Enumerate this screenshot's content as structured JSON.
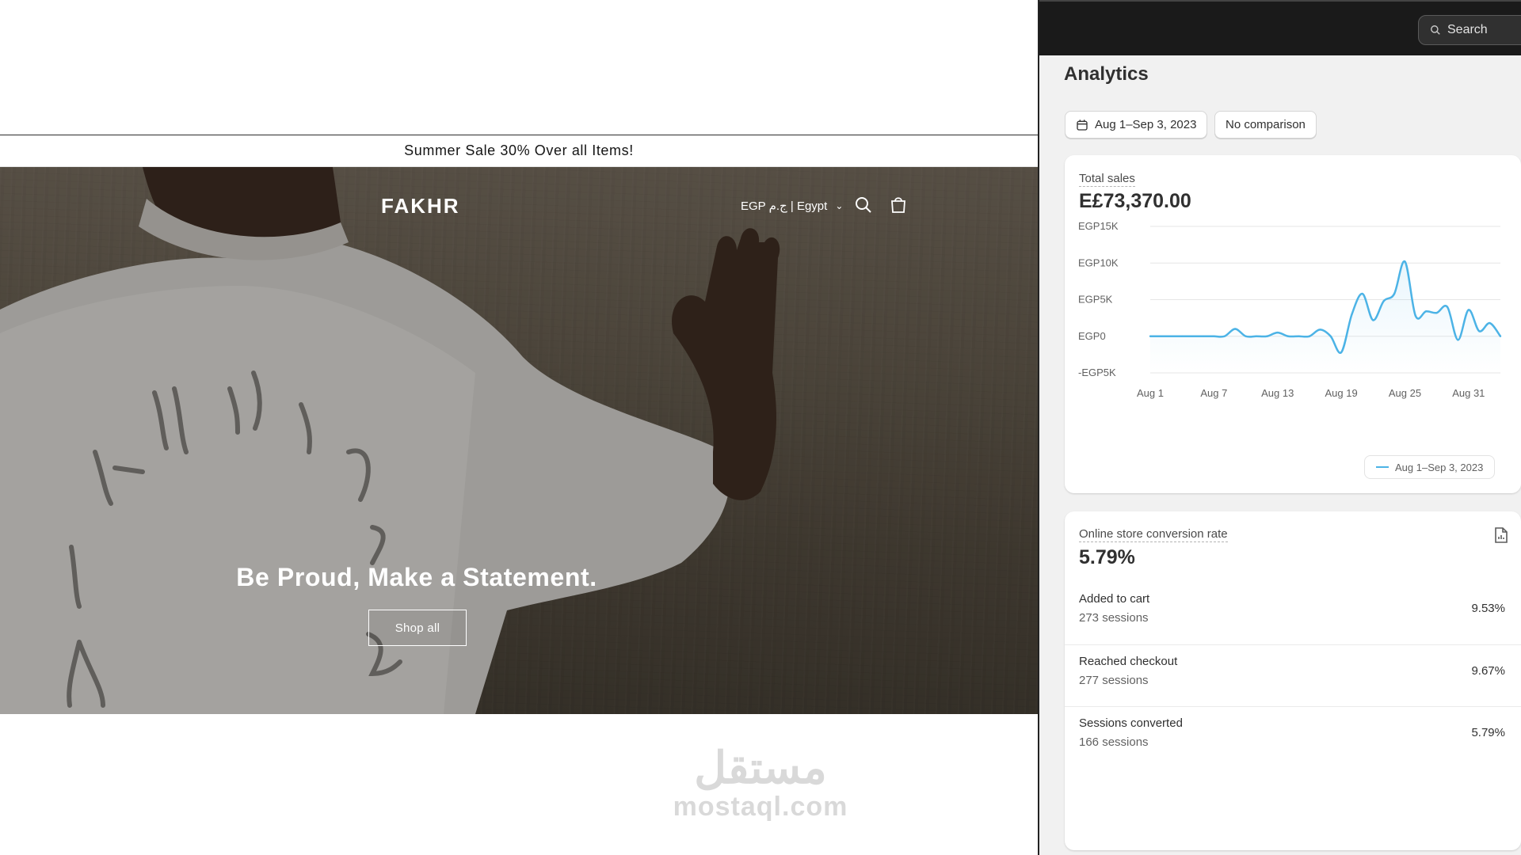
{
  "storefront": {
    "announcement": "Summer Sale 30% Over all Items!",
    "brand": "FAKHR",
    "locale": "EGP ج.م | Egypt",
    "hero_heading": "Be Proud, Make a Statement.",
    "cta_label": "Shop all"
  },
  "watermark": {
    "arabic": "مستقل",
    "latin": "mostaql.com"
  },
  "admin": {
    "search_label": "Search",
    "page_title": "Analytics",
    "date_range": "Aug 1–Sep 3, 2023",
    "comparison": "No comparison",
    "total_sales": {
      "label": "Total sales",
      "value": "E£73,370.00",
      "legend": "Aug 1–Sep 3, 2023",
      "chart_data": {
        "type": "line",
        "title": "",
        "xlabel": "",
        "ylabel": "",
        "y_ticks": [
          "EGP15K",
          "EGP10K",
          "EGP5K",
          "EGP0",
          "-EGP5K"
        ],
        "y_tick_values": [
          15000,
          10000,
          5000,
          0,
          -5000
        ],
        "x_ticks": [
          "Aug 1",
          "Aug 7",
          "Aug 13",
          "Aug 19",
          "Aug 25",
          "Aug 31"
        ],
        "ylim": [
          -5000,
          15000
        ],
        "x": [
          "Aug 1",
          "Aug 2",
          "Aug 3",
          "Aug 4",
          "Aug 5",
          "Aug 6",
          "Aug 7",
          "Aug 8",
          "Aug 9",
          "Aug 10",
          "Aug 11",
          "Aug 12",
          "Aug 13",
          "Aug 14",
          "Aug 15",
          "Aug 16",
          "Aug 17",
          "Aug 18",
          "Aug 19",
          "Aug 20",
          "Aug 21",
          "Aug 22",
          "Aug 23",
          "Aug 24",
          "Aug 25",
          "Aug 26",
          "Aug 27",
          "Aug 28",
          "Aug 29",
          "Aug 30",
          "Aug 31",
          "Sep 1",
          "Sep 2",
          "Sep 3"
        ],
        "series": [
          {
            "name": "Aug 1–Sep 3, 2023",
            "color": "#4cb3e6",
            "values": [
              0,
              0,
              0,
              0,
              0,
              0,
              0,
              0,
              1000,
              0,
              0,
              0,
              500,
              0,
              0,
              0,
              900,
              0,
              -2200,
              3000,
              5800,
              2200,
              4800,
              5800,
              10200,
              2800,
              3400,
              3200,
              4000,
              -500,
              3600,
              700,
              1800,
              0
            ]
          }
        ]
      }
    },
    "conversion": {
      "label": "Online store conversion rate",
      "value": "5.79%",
      "icon": "report-icon",
      "rows": [
        {
          "name": "Added to cart",
          "sessions": "273 sessions",
          "pct": "9.53%"
        },
        {
          "name": "Reached checkout",
          "sessions": "277 sessions",
          "pct": "9.67%"
        },
        {
          "name": "Sessions converted",
          "sessions": "166 sessions",
          "pct": "5.79%"
        }
      ]
    }
  }
}
